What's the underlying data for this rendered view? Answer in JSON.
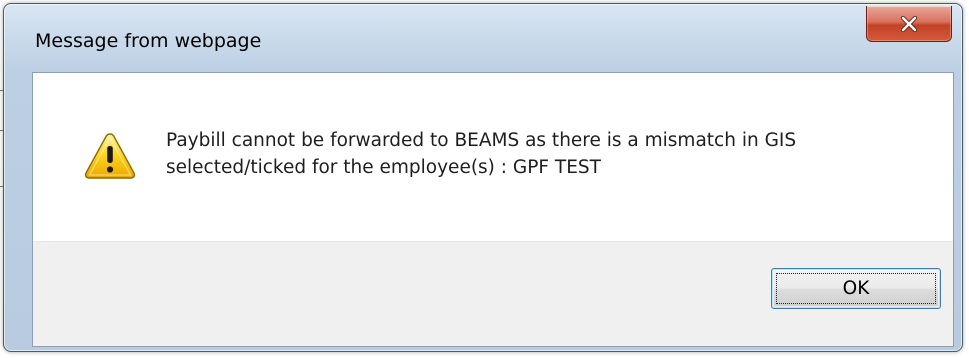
{
  "dialog": {
    "title": "Message from webpage",
    "message_lines": [
      "Paybill cannot be forwarded to BEAMS as there is a mismatch in GIS",
      "selected/ticked for the employee(s) : GPF TEST"
    ],
    "icon": "warning-icon",
    "close_icon": "close-icon",
    "buttons": {
      "ok_label": "OK"
    }
  },
  "colors": {
    "frame": "#c7d8ea",
    "close_button": "#c24226",
    "warning_fill": "#f5c400",
    "footer": "#f0f0f0",
    "ok_border": "#3c7fb1"
  }
}
